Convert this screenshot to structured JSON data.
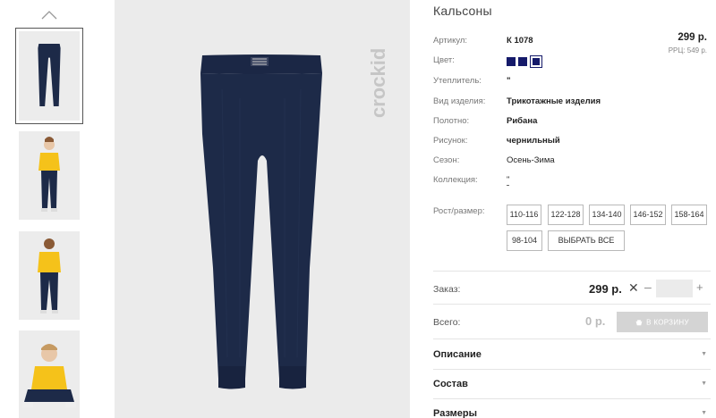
{
  "product": {
    "title": "Кальсоны",
    "price": "299 р.",
    "rrp": "РРЦ: 549 р.",
    "brand": "crockid"
  },
  "attributes": {
    "article": {
      "label": "Артикул:",
      "value": "К 1078"
    },
    "color": {
      "label": "Цвет:",
      "swatches": [
        "#151a6a",
        "#151a6a",
        "#151a6a"
      ],
      "selected_index": 2
    },
    "insulation": {
      "label": "Утеплитель:",
      "value": "\""
    },
    "product_type": {
      "label": "Вид изделия:",
      "value": "Трикотажные изделия"
    },
    "fabric": {
      "label": "Полотно:",
      "value": "Рибана"
    },
    "pattern": {
      "label": "Рисунок:",
      "value": "чернильный"
    },
    "season": {
      "label": "Сезон:",
      "value": "Осень-Зима"
    },
    "collection": {
      "label": "Коллекция:",
      "value": "\""
    }
  },
  "sizes": {
    "label": "Рост/размер:",
    "options": [
      "110-116",
      "122-128",
      "134-140",
      "146-152",
      "158-164",
      "98-104"
    ],
    "select_all": "ВЫБРАТЬ ВСЕ"
  },
  "order": {
    "label": "Заказ:",
    "price": "299 р.",
    "remove": "✕",
    "minus": "–",
    "plus": "+",
    "quantity": ""
  },
  "total": {
    "label": "Всего:",
    "value": "0 р.",
    "cart_button": "В КОРЗИНУ"
  },
  "accordion": [
    {
      "title": "Описание"
    },
    {
      "title": "Состав"
    },
    {
      "title": "Размеры"
    }
  ],
  "colors": {
    "navy": "#151a6a",
    "leggings": "#1d2a48",
    "shirt": "#f5c21a",
    "cart_disabled": "#d4d4d4"
  }
}
